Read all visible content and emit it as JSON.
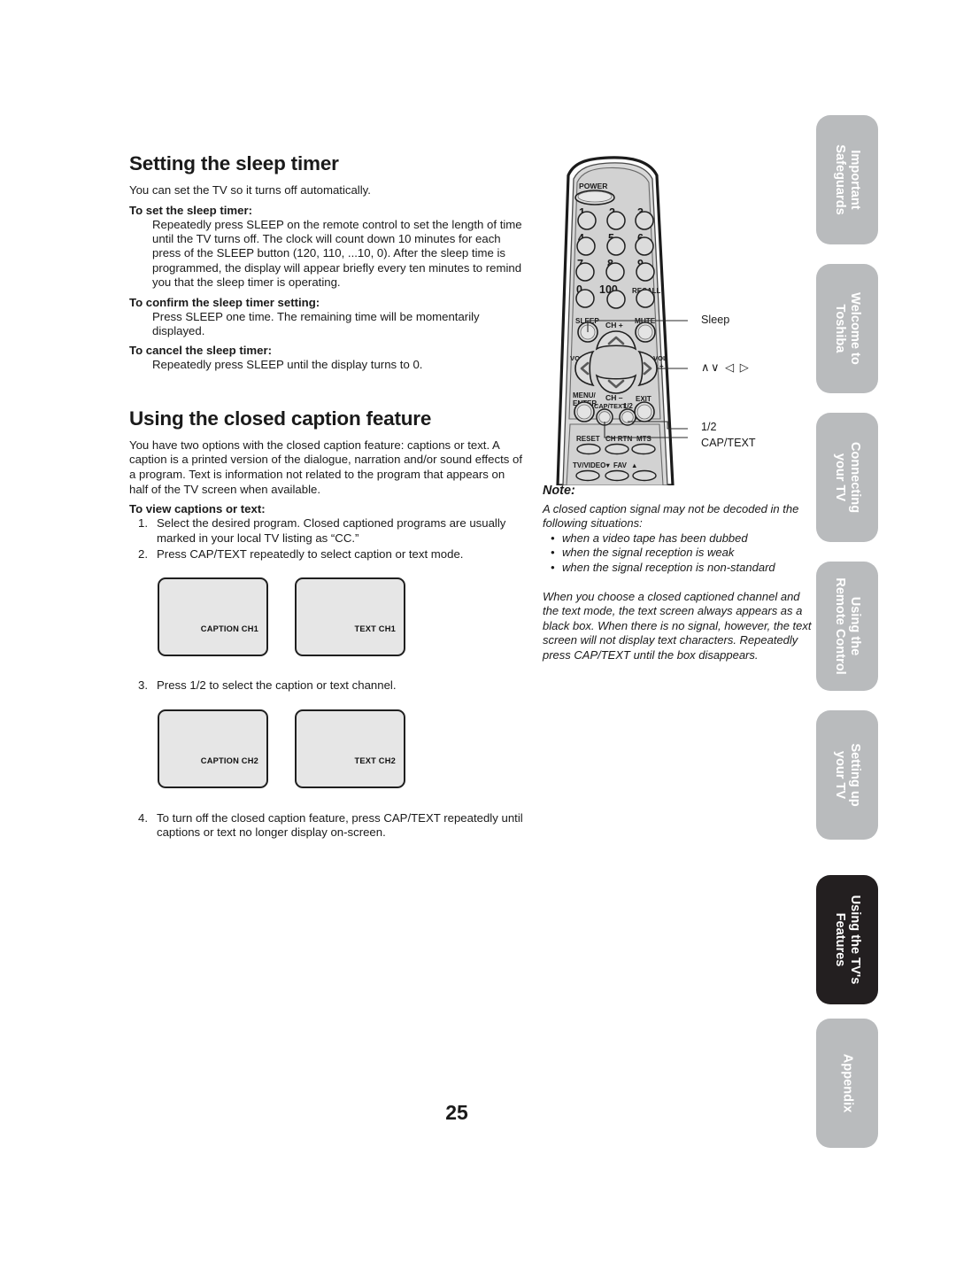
{
  "page": {
    "number": "25"
  },
  "sleep_section": {
    "title": "Setting the sleep timer",
    "intro": "You can set the TV so it turns off automatically.",
    "subsections": [
      {
        "heading": "To set the sleep timer:",
        "body": "Repeatedly press SLEEP on the remote control to set the length of time until the TV turns off. The clock will count down 10 minutes for each press of the SLEEP button (120, 110, ...10, 0). After the sleep time is programmed, the display will appear briefly every ten minutes to remind you that the sleep timer is operating."
      },
      {
        "heading": "To confirm the sleep timer setting:",
        "body": "Press SLEEP one time. The remaining time will be momentarily displayed."
      },
      {
        "heading": "To cancel the sleep timer:",
        "body": "Repeatedly press SLEEP until the display turns to 0."
      }
    ]
  },
  "caption_section": {
    "title": "Using the closed caption feature",
    "intro": "You have two options with the closed caption feature: captions or text. A caption is a printed version of the dialogue, narration and/or sound effects of a program. Text is information not related to the program that appears on half of the TV screen when available.",
    "steps_heading": "To view captions or text:",
    "step1_num": "1.",
    "step1_text": "Select the desired program. Closed captioned programs are usually marked in your local TV listing as “CC.”",
    "step2_num": "2.",
    "step2_text": "Press CAP/TEXT repeatedly to select caption or text mode.",
    "step3_num": "3.",
    "step3_text": "Press 1/2 to select the caption or text channel.",
    "step4_num": "4.",
    "step4_text": "To turn off the closed caption feature, press CAP/TEXT repeatedly until captions or text no longer display on-screen.",
    "screens_row1": {
      "left_label": "CAPTION CH1",
      "right_label": "TEXT CH1"
    },
    "screens_row2": {
      "left_label": "CAPTION CH2",
      "right_label": "TEXT CH2"
    }
  },
  "remote": {
    "power_label": "POWER",
    "number_buttons": [
      "1",
      "2",
      "3",
      "4",
      "5",
      "6",
      "7",
      "8",
      "9",
      "0",
      "100"
    ],
    "recall_label": "RECALL",
    "sleep_label": "SLEEP",
    "mute_label": "MUTE",
    "ch_up_label": "CH +",
    "ch_down_label": "CH –",
    "vol_minus_label": "VOL",
    "vol_minus_sign": "–",
    "vol_plus_label": "VOL",
    "vol_plus_sign": "+",
    "menu_enter_label_line1": "MENU/",
    "menu_enter_label_line2": "ENTER",
    "exit_label": "EXIT",
    "cap_text_label": "CAP/TEXT",
    "one_two_label": "1/2",
    "reset_label": "RESET",
    "ch_rtn_label": "CH RTN",
    "mts_label": "MTS",
    "tv_video_label": "TV/VIDEO",
    "fav_label": "FAV",
    "fav_down_glyph": "▼",
    "fav_up_glyph": "▲"
  },
  "callouts": {
    "sleep": "Sleep",
    "arrows": "∧∨ ◁ ▷",
    "one_two": "1/2",
    "cap_text": "CAP/TEXT"
  },
  "note": {
    "heading": "Note:",
    "para1": "A closed caption signal may not be decoded in the following situations:",
    "bullets": [
      "when a video tape has been dubbed",
      "when the signal reception is weak",
      "when the signal reception is non-standard"
    ],
    "para2": "When you choose a closed captioned channel and the text mode, the text screen always appears as a black box. When there is no signal, however, the text screen will not display text characters. Repeatedly press CAP/TEXT until the box disappears."
  },
  "tabs": [
    {
      "label": "Important\nSafeguards",
      "line1": "Important",
      "line2": "Safeguards",
      "active": false
    },
    {
      "label": "Welcome to\nToshiba",
      "line1": "Welcome to",
      "line2": "Toshiba",
      "active": false
    },
    {
      "label": "Connecting\nyour TV",
      "line1": "Connecting",
      "line2": "your TV",
      "active": false
    },
    {
      "label": "Using the\nRemote Control",
      "line1": "Using the",
      "line2": "Remote Control",
      "active": false
    },
    {
      "label": "Setting up\nyour TV",
      "line1": "Setting up",
      "line2": "your TV",
      "active": false
    },
    {
      "label": "Using the TV's\nFeatures",
      "line1": "Using the TV's",
      "line2": "Features",
      "active": true
    },
    {
      "label": "Appendix",
      "line1": "Appendix",
      "line2": "",
      "active": false
    }
  ],
  "colors": {
    "tab_inactive": "#b9bbbd",
    "tab_active": "#231f20",
    "screen_fill": "#e6e6e6",
    "remote_body": "#d6d6d6",
    "text": "#1a1a1a"
  }
}
